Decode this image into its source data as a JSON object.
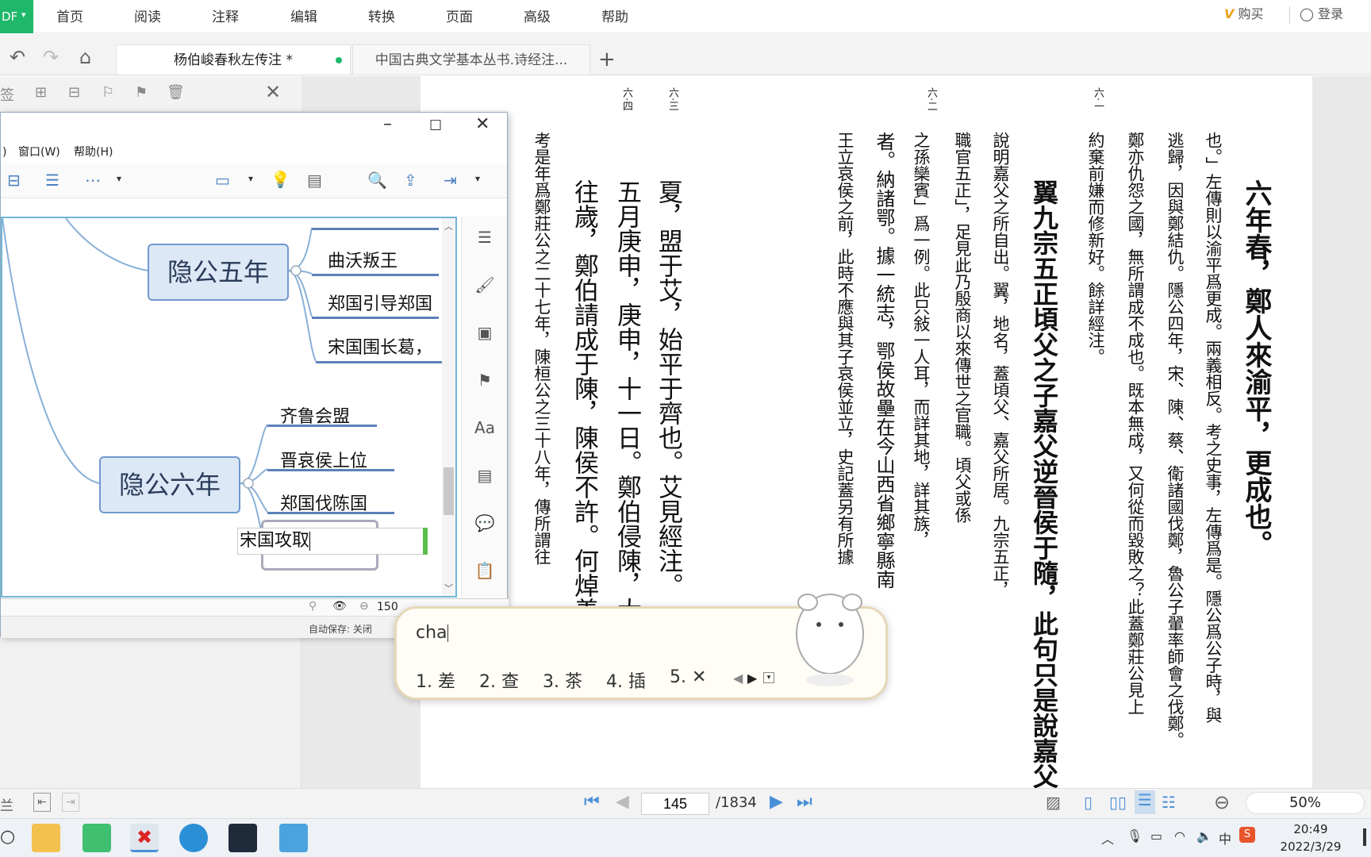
{
  "menubar": {
    "app_badge": "DF",
    "items": [
      "首页",
      "阅读",
      "注释",
      "编辑",
      "转换",
      "页面",
      "高级",
      "帮助"
    ],
    "buy": "购买",
    "login": "登录"
  },
  "tabs": [
    {
      "label": "杨伯峻春秋左传注 *"
    },
    {
      "label": "中国古典文学基本丛书.诗经注..."
    }
  ],
  "pdf": {
    "page_markers": [
      "六·一",
      "六·二",
      "六·三",
      "六·四"
    ],
    "columns": [
      "六年春，鄭人來渝平，更成也。",
      "也。」左傳則以渝平爲更成。兩義相反。考之史事，左傳爲是。隱公爲公子時，與",
      "逃歸，因與鄭結仇。隱公四年，宋、陳、蔡、衛諸國伐鄭，魯公子翬率師會之伐鄭。",
      "鄭亦仇怨之國，無所謂成不成也。既本無成，又何從而毀敗之？此蓋鄭莊公見上",
      "約棄前嫌而修新好。餘詳經注。",
      "翼九宗五正頃父之子嘉父逆晉侯于隨，此句只是說嘉父迎晉",
      "說明嘉父之所自出。翼，地名，蓋頃父、嘉父所居。九宗五正，",
      "職官五正」，足見此乃殷商以來傳世之官職。頃父或係",
      "之孫欒賓」爲一例。此只敍一人耳，而詳其地，詳其族，",
      "者。納諸鄂。據一統志，鄂侯故壘在今山西省鄉寧縣南",
      "王立哀侯之前，此時不應與其子哀侯並立，史記蓋另有所據",
      "夏，盟于艾，始平于齊也。艾見經注。",
      "五月庚申，庚申，十一日。鄭伯侵陳，大獲。",
      "往歲，鄭伯請成于陳，陳侯不許。何焯義門",
      "考是年爲鄭莊公之二十七年，陳桓公之三十八年，傳所謂往"
    ]
  },
  "panel": {
    "close": "✕"
  },
  "mindmap": {
    "menu": [
      ")",
      "窗口(W)",
      "帮助(H)"
    ],
    "topics": [
      "隐公五年",
      "隐公六年"
    ],
    "subtopics_5": [
      "曲沃叛王",
      "郑国引导郑国",
      "宋国围长葛，"
    ],
    "subtopics_6": [
      "齐鲁会盟",
      "晋哀侯上位",
      "郑国伐陈国"
    ],
    "editing_text": "宋国攻取",
    "zoom": "150",
    "autosave": "自动保存: 关闭"
  },
  "ime": {
    "input": "cha",
    "candidates": [
      "1. 差",
      "2. 查",
      "3. 茶",
      "4. 插",
      "5. ✕"
    ]
  },
  "statusbar": {
    "left_label": "兰",
    "current_page": "145",
    "total_pages": "/1834",
    "zoom": "50%"
  },
  "taskbar": {
    "time": "20:49",
    "date": "2022/3/29",
    "ime_lang": "中"
  },
  "colors": {
    "accent_green": "#1fb86b",
    "mindmap_border": "#6f99cf",
    "topic_fill": "#dde8f6"
  }
}
